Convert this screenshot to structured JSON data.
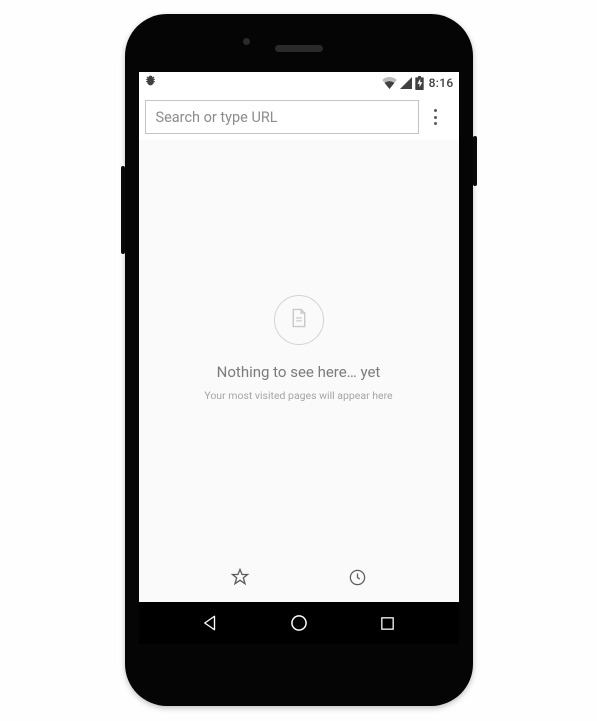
{
  "status_bar": {
    "time": "8:16"
  },
  "omnibox": {
    "placeholder": "Search or type URL",
    "value": ""
  },
  "empty_state": {
    "title": "Nothing to see here… yet",
    "subtitle": "Your most visited pages will appear here"
  }
}
